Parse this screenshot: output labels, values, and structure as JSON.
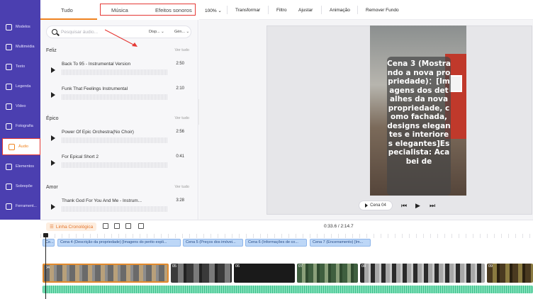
{
  "nav": {
    "items": [
      {
        "label": "Modelos",
        "icon": "templates-icon"
      },
      {
        "label": "Multimédia",
        "icon": "media-icon"
      },
      {
        "label": "Texto",
        "icon": "text-icon"
      },
      {
        "label": "Legenda",
        "icon": "subtitle-icon"
      },
      {
        "label": "Vídeo",
        "icon": "video-icon"
      },
      {
        "label": "Fotografia",
        "icon": "photo-icon"
      },
      {
        "label": "Áudio",
        "icon": "audio-icon",
        "active": true
      },
      {
        "label": "Elementos",
        "icon": "elements-icon"
      },
      {
        "label": "Sobrepõe",
        "icon": "overlay-icon"
      },
      {
        "label": "Ferrament...",
        "icon": "tools-icon"
      }
    ]
  },
  "panel": {
    "tabs": {
      "all": "Tudo",
      "music": "Música",
      "effects": "Efeitos sonoros"
    },
    "search": {
      "placeholder": "Pesquisar áudio...",
      "dropdown1": "Disp...",
      "dropdown2": "Gén..."
    },
    "see_all": "Ver tudo",
    "sections": [
      {
        "title": "Feliz",
        "tracks": [
          {
            "name": "Back To 95 - Instrumental Version",
            "duration": "2:50"
          },
          {
            "name": "Funk That Feelings Instrumental",
            "duration": "2:10"
          }
        ]
      },
      {
        "title": "Épico",
        "tracks": [
          {
            "name": "Power Of Epic Orchestra(No Choir)",
            "duration": "2:56"
          },
          {
            "name": "For Epical Short 2",
            "duration": "0:41"
          }
        ]
      },
      {
        "title": "Amor",
        "tracks": [
          {
            "name": "Thank God For You And Me - Instrum...",
            "duration": "3:28"
          }
        ]
      }
    ]
  },
  "toolbar": {
    "zoom": "100%",
    "items": [
      "Transformar",
      "Filtro",
      "Ajustar",
      "Animação",
      "Remover Fundo"
    ]
  },
  "canvas": {
    "caption": "Cena 3 (Mostrando a nova propriedade)：[Imagens dos detalhes da nova propriedade, como fachada, designs elegantes e interiores elegantes]Especialista: Acabei de",
    "scene_button": "Cena 04"
  },
  "timeline": {
    "label": "Linha Cronológica",
    "time": "0:33.6 / 2:14.7",
    "scene_tags": [
      "Ce...",
      "Cena 4 (Descrição da propriedade) [Imagens do perito expli...",
      "Cena 5 (Preços dos imóvei...",
      "Cena 6 (Informações de co...",
      "Cena 7 (Encerramento) [Im..."
    ],
    "clips": [
      "04",
      "05",
      "06",
      "07",
      "08",
      "09"
    ]
  },
  "colors": {
    "nav_bg": "#4b3fb0",
    "accent": "#f0831f",
    "highlight": "#e53935",
    "audio_track": "#7fe0b8"
  }
}
